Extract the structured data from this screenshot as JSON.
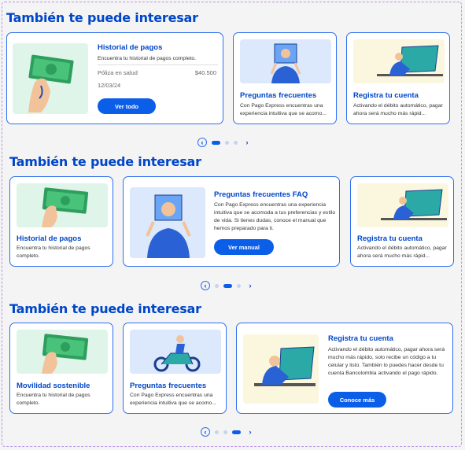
{
  "sections": [
    {
      "title": "También te puede interesar",
      "featured": {
        "title": "Historial de pagos",
        "desc": "Encuentra tu historial de pagos completo.",
        "meta_label": "Póliza en salud",
        "meta_amount": "$40.500",
        "meta_date": "12/03/24",
        "button": "Ver todo"
      },
      "cards": [
        {
          "title": "Preguntas frecuentes",
          "desc": "Con Pago Express encuentras una experiencia intuitiva que se acomo..."
        },
        {
          "title": "Registra tu cuenta",
          "desc": "Activando el débito automático, pagar ahora será mucho más rápid..."
        }
      ]
    },
    {
      "title": "También te puede interesar",
      "cards": [
        {
          "title": "Historial de pagos",
          "desc": "Encuentra tu historial de pagos completo."
        },
        {
          "title": "Registra tu cuenta",
          "desc": "Activando el débito automático, pagar ahora será mucho más rápid..."
        }
      ],
      "featured": {
        "title": "Preguntas frecuentes FAQ",
        "desc": "Con Pago Express encuentras una experiencia intuitiva que se acomoda a tus preferencias y estilo de vida. Si tienes dudas, conoce el manual que hemos preparado para ti.",
        "button": "Ver manual"
      }
    },
    {
      "title": "También te puede interesar",
      "cards": [
        {
          "title": "Movilidad sostenible",
          "desc": "Encuentra tu historial de pagos completo."
        },
        {
          "title": "Preguntas frecuentes",
          "desc": "Con Pago Express encuentras una experiencia intuitiva que se acomo..."
        }
      ],
      "featured": {
        "title": "Registra tu cuenta",
        "desc": "Activando el débito automático, pagar ahora será mucho más rápido, solo recibe un código a tu celular y listo. También lo puedes hacer desde tu cuenta Bancolombia activando el pago rápido.",
        "button": "Conoce más"
      }
    }
  ],
  "pager": {
    "prev": "‹",
    "next": "›"
  },
  "colors": {
    "accent": "#0046c8",
    "button": "#0b5ee8",
    "card_border": "#2f6ff0",
    "frame": "#b995e6"
  }
}
